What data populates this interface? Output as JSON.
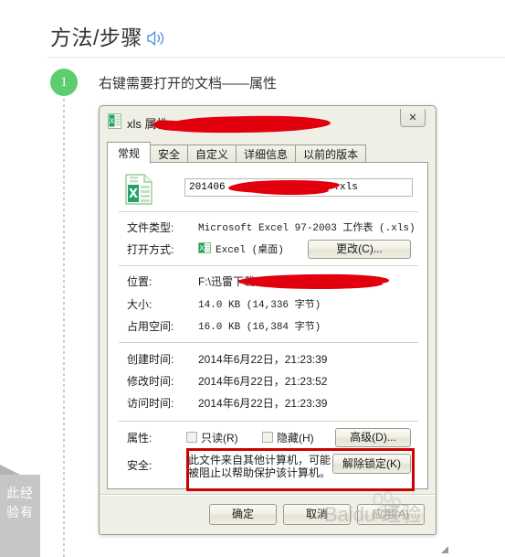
{
  "article": {
    "section_title": "方法/步骤",
    "speaker_icon": "speaker-icon",
    "step_number": "1",
    "step_text": "右键需要打开的文档——属性"
  },
  "side_tab": {
    "text": "此经验有"
  },
  "watermark": {
    "text": "Baidu 经验"
  },
  "dialog": {
    "title_prefix": "",
    "title_suffix": "xls 属性",
    "icon": "excel-file-icon",
    "close_label": "✕",
    "tabs": [
      {
        "label": "常规",
        "active": true
      },
      {
        "label": "安全",
        "active": false
      },
      {
        "label": "自定义",
        "active": false
      },
      {
        "label": "详细信息",
        "active": false
      },
      {
        "label": "以前的版本",
        "active": false
      }
    ],
    "filename": {
      "prefix": "201406",
      "suffix": ".xls"
    },
    "rows": [
      {
        "label": "文件类型:",
        "value": "Microsoft Excel 97-2003 工作表 (.xls)"
      },
      {
        "label": "打开方式:",
        "value": "Excel (桌面)"
      },
      {
        "label": "位置:",
        "value": "F:\\迅雷下载\\201406"
      },
      {
        "label": "大小:",
        "value": "14.0 KB (14,336 字节)"
      },
      {
        "label": "占用空间:",
        "value": "16.0 KB (16,384 字节)"
      },
      {
        "label": "创建时间:",
        "value": "2014年6月22日，21:23:39"
      },
      {
        "label": "修改时间:",
        "value": "2014年6月22日，21:23:52"
      },
      {
        "label": "访问时间:",
        "value": "2014年6月22日，21:23:39"
      },
      {
        "label": "属性:",
        "value": ""
      },
      {
        "label": "安全:",
        "value": ""
      }
    ],
    "change_button": "更改(C)...",
    "attributes": {
      "readonly_label": "只读(R)",
      "readonly_checked": false,
      "hidden_label": "隐藏(H)",
      "hidden_checked": false,
      "advanced_button": "高级(D)..."
    },
    "security": {
      "message_line1": "此文件来自其他计算机，可能",
      "message_line2": "被阻止以帮助保护该计算机。",
      "unblock_button": "解除锁定(K)"
    },
    "footer": {
      "ok": "确定",
      "cancel": "取消",
      "apply": "应用(A)",
      "apply_disabled": true
    }
  },
  "colors": {
    "step_green": "#5ecc71",
    "redaction_red": "#e2000f",
    "highlight_box_red": "#cc0000",
    "dialog_bg": "#f0efe6"
  }
}
